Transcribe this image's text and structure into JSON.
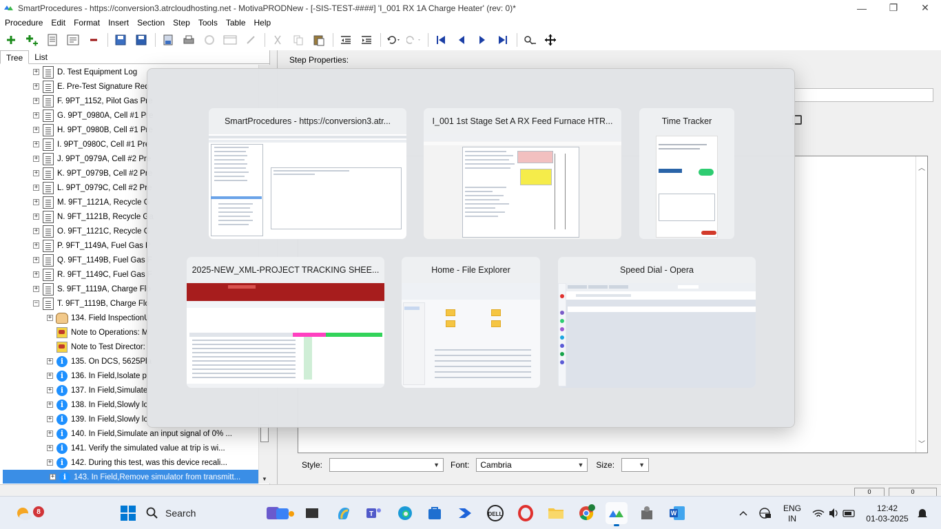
{
  "window": {
    "title": "SmartProcedures - https://conversion3.atrcloudhosting.net - MotivaPRODNew - [-SIS-TEST-####] 'I_001 RX 1A Charge Heater' (rev: 0)*",
    "minimize": "—",
    "maximize": "❐",
    "close": "✕"
  },
  "menu": [
    "Procedure",
    "Edit",
    "Format",
    "Insert",
    "Section",
    "Step",
    "Tools",
    "Table",
    "Help"
  ],
  "left_tabs": [
    "Tree",
    "List"
  ],
  "tree_items": [
    {
      "label": "D. Test Equipment Log",
      "icon": "document-icon",
      "expander": "+"
    },
    {
      "label": "E. Pre-Test Signature Req",
      "icon": "document-icon",
      "expander": "+"
    },
    {
      "label": "F. 9PT_1152, Pilot Gas Pre",
      "icon": "document-icon",
      "expander": "+"
    },
    {
      "label": "G. 9PT_0980A, Cell #1 Pre",
      "icon": "document-icon",
      "expander": "+"
    },
    {
      "label": "H. 9PT_0980B, Cell #1 Pre",
      "icon": "document-icon",
      "expander": "+"
    },
    {
      "label": "I. 9PT_0980C, Cell #1 Pre",
      "icon": "document-icon",
      "expander": "+"
    },
    {
      "label": "J. 9PT_0979A, Cell #2 Pre",
      "icon": "document-icon",
      "expander": "+"
    },
    {
      "label": "K. 9PT_0979B, Cell #2 Pre",
      "icon": "document-icon",
      "expander": "+"
    },
    {
      "label": "L. 9PT_0979C, Cell #2 Pre",
      "icon": "document-icon",
      "expander": "+"
    },
    {
      "label": "M. 9FT_1121A, Recycle G",
      "icon": "document-icon",
      "expander": "+"
    },
    {
      "label": "N. 9FT_1121B, Recycle Ga",
      "icon": "document-icon",
      "expander": "+"
    },
    {
      "label": "O. 9FT_1121C, Recycle G",
      "icon": "document-icon",
      "expander": "+"
    },
    {
      "label": "P. 9FT_1149A, Fuel Gas P",
      "icon": "document-icon",
      "expander": "+"
    },
    {
      "label": "Q. 9FT_1149B, Fuel Gas F",
      "icon": "document-icon",
      "expander": "+"
    },
    {
      "label": "R. 9FT_1149C, Fuel Gas F",
      "icon": "document-icon",
      "expander": "+"
    },
    {
      "label": "S. 9FT_1119A, Charge Flo",
      "icon": "document-icon",
      "expander": "+"
    },
    {
      "label": "T. 9FT_1119B, Charge Flo",
      "icon": "document-icon",
      "expander": "−"
    },
    {
      "label": "134. Field InspectionU",
      "icon": "hand-icon",
      "expander": "+",
      "indent": 1
    },
    {
      "label": "Note to Operations: M",
      "icon": "note-icon",
      "expander": "",
      "indent": 1
    },
    {
      "label": "Note to Test Director:",
      "icon": "note-icon",
      "expander": "",
      "indent": 1
    },
    {
      "label": "135. On DCS, 5625Pla",
      "icon": "info-icon",
      "expander": "+",
      "indent": 1
    },
    {
      "label": "136. In Field,Isolate p",
      "icon": "info-icon",
      "expander": "+",
      "indent": 1
    },
    {
      "label": "137. In Field,Simulate",
      "icon": "info-icon",
      "expander": "+",
      "indent": 1
    },
    {
      "label": "138. In Field,Slowly lo",
      "icon": "info-icon",
      "expander": "+",
      "indent": 1
    },
    {
      "label": "139. In Field,Slowly lo",
      "icon": "info-icon",
      "expander": "+",
      "indent": 1
    },
    {
      "label": "140. In Field,Simulate an input signal of 0% ...",
      "icon": "info-icon",
      "expander": "+",
      "indent": 1
    },
    {
      "label": "141. Verify the simulated value at trip is wi...",
      "icon": "info-icon",
      "expander": "+",
      "indent": 1
    },
    {
      "label": "142. During this test, was this device recali...",
      "icon": "info-icon",
      "expander": "+",
      "indent": 1
    },
    {
      "label": "143. In Field,Remove simulator from transmitt...",
      "icon": "info-icon",
      "expander": "+",
      "indent": 1,
      "selected": true
    }
  ],
  "right_panel": {
    "step_properties": "Step Properties:",
    "style_label": "Style:",
    "style_value": "",
    "font_label": "Font:",
    "font_value": "Cambria",
    "size_label": "Size:",
    "size_value": ""
  },
  "status_cells": [
    "0",
    "0"
  ],
  "switcher": {
    "cards": [
      {
        "title": "SmartProcedures - https://conversion3.atr...",
        "kind": "app"
      },
      {
        "title": "I_001 1st Stage Set A RX Feed Furnace HTR...",
        "kind": "doc"
      },
      {
        "title": "Time Tracker",
        "kind": "tracker"
      },
      {
        "title": "2025-NEW_XML-PROJECT TRACKING SHEE...",
        "kind": "sheet"
      },
      {
        "title": "Home - File Explorer",
        "kind": "explorer"
      },
      {
        "title": "Speed Dial - Opera",
        "kind": "browser"
      }
    ]
  },
  "taskbar": {
    "weather_badge": "8",
    "search_label": "Search",
    "lang_top": "ENG",
    "lang_bottom": "IN",
    "time": "12:42",
    "date": "01-03-2025",
    "icons": [
      "widgets-icon",
      "windows-start-icon",
      "search-icon",
      "photos-icon",
      "terminal-icon",
      "copilot-icon",
      "teams-icon",
      "edge-icon",
      "store-icon",
      "power-automate-icon",
      "dell-icon",
      "opera-icon",
      "file-explorer-icon",
      "chrome-icon",
      "smartprocedures-icon",
      "time-tracker-icon",
      "word-icon"
    ]
  },
  "colors": {
    "selection": "#3a8ee6",
    "info": "#1e90ff",
    "accent": "#0067c0",
    "sheet_red": "#c5221f",
    "sheet_green": "#32d35a",
    "toggle_green": "#2ecc71"
  }
}
